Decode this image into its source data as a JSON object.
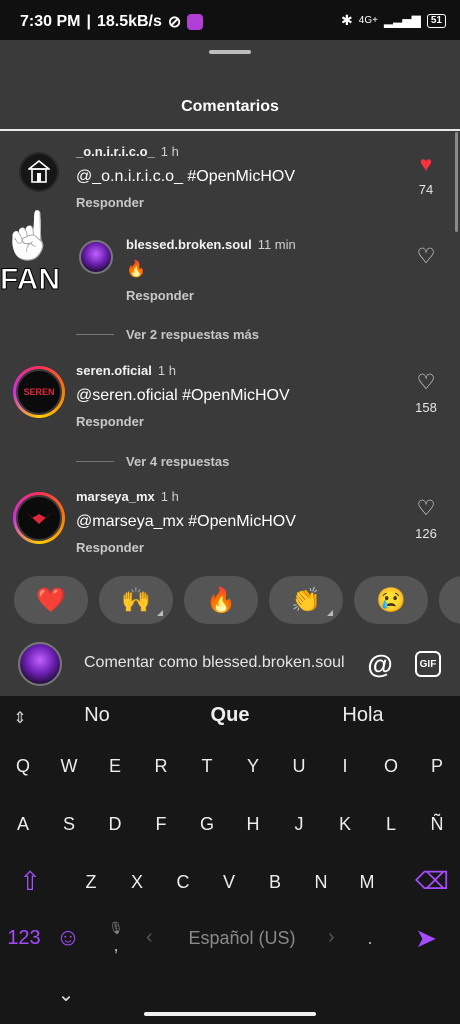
{
  "status": {
    "time": "7:30 PM",
    "speed": "18.5kB/s",
    "network": "4G+",
    "battery": "51"
  },
  "sheet": {
    "title": "Comentarios"
  },
  "fan_sticker": "FAN",
  "comments": [
    {
      "user": "_o.n.i.r.i.c.o_",
      "time": "1 h",
      "text": "@_o.n.i.r.i.c.o_ #OpenMicHOV",
      "reply": "Responder",
      "likes": "74",
      "liked": true
    },
    {
      "user": "blessed.broken.soul",
      "time": "11 min",
      "text": "🔥",
      "reply": "Responder",
      "likes": "",
      "liked": false
    },
    {
      "user": "seren.oficial",
      "time": "1 h",
      "text": "@seren.oficial #OpenMicHOV",
      "reply": "Responder",
      "likes": "158",
      "liked": false,
      "avatar_text": "SEREN"
    },
    {
      "user": "marseya_mx",
      "time": "1 h",
      "text": "@marseya_mx #OpenMicHOV",
      "reply": "Responder",
      "likes": "126",
      "liked": false
    }
  ],
  "more_replies": [
    "Ver 2 respuestas más",
    "Ver 4 respuestas"
  ],
  "emojis": [
    "❤️",
    "🙌",
    "🔥",
    "👏",
    "😢"
  ],
  "composer": {
    "placeholder": "Comentar como blessed.broken.soul",
    "at": "@",
    "gif": "GIF"
  },
  "keyboard": {
    "suggestions": [
      "No",
      "Que",
      "Hola"
    ],
    "row1": [
      "Q",
      "W",
      "E",
      "R",
      "T",
      "Y",
      "U",
      "I",
      "O",
      "P"
    ],
    "row2": [
      "A",
      "S",
      "D",
      "F",
      "G",
      "H",
      "J",
      "K",
      "L",
      "Ñ"
    ],
    "row3": [
      "Z",
      "X",
      "C",
      "V",
      "B",
      "N",
      "M"
    ],
    "numbers_key": "123",
    "space_label": "Español (US)",
    "comma": ",",
    "period": "."
  },
  "colors": {
    "accent": "#a64bff",
    "like_red": "#ff3040",
    "sheet_bg": "#3a3a3a",
    "keyboard_bg": "#171717"
  }
}
